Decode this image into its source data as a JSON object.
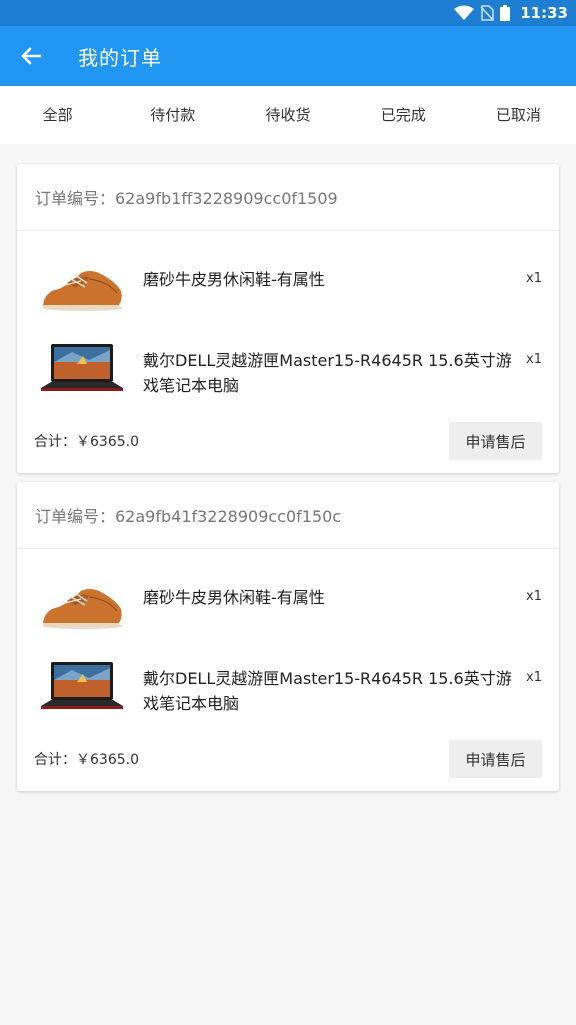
{
  "status_bar": {
    "time": "11:33",
    "icons": [
      "wifi-icon",
      "no-sim-icon",
      "battery-icon"
    ]
  },
  "header": {
    "title": "我的订单",
    "back_icon": "arrow-left-icon"
  },
  "tabs": [
    {
      "label": "全部"
    },
    {
      "label": "待付款"
    },
    {
      "label": "待收货"
    },
    {
      "label": "已完成"
    },
    {
      "label": "已取消"
    }
  ],
  "orders": [
    {
      "order_no": "订单编号：62a9fb1ff3228909cc0f1509",
      "items": [
        {
          "name": "磨砂牛皮男休闲鞋-有属性",
          "qty": "x1",
          "thumb": "shoe-image"
        },
        {
          "name": "戴尔DELL灵越游匣Master15-R4645R 15.6英寸游戏笔记本电脑",
          "qty": "x1",
          "thumb": "laptop-image"
        }
      ],
      "total": "合计：￥6365.0",
      "action_label": "申请售后"
    },
    {
      "order_no": "订单编号：62a9fb41f3228909cc0f150c",
      "items": [
        {
          "name": "磨砂牛皮男休闲鞋-有属性",
          "qty": "x1",
          "thumb": "shoe-image"
        },
        {
          "name": "戴尔DELL灵越游匣Master15-R4645R 15.6英寸游戏笔记本电脑",
          "qty": "x1",
          "thumb": "laptop-image"
        }
      ],
      "total": "合计：￥6365.0",
      "action_label": "申请售后"
    }
  ],
  "colors": {
    "status_bar": "#1e7fd2",
    "app_bar": "#2196f3",
    "background": "#f7f7f7",
    "button": "#eeeeee"
  }
}
